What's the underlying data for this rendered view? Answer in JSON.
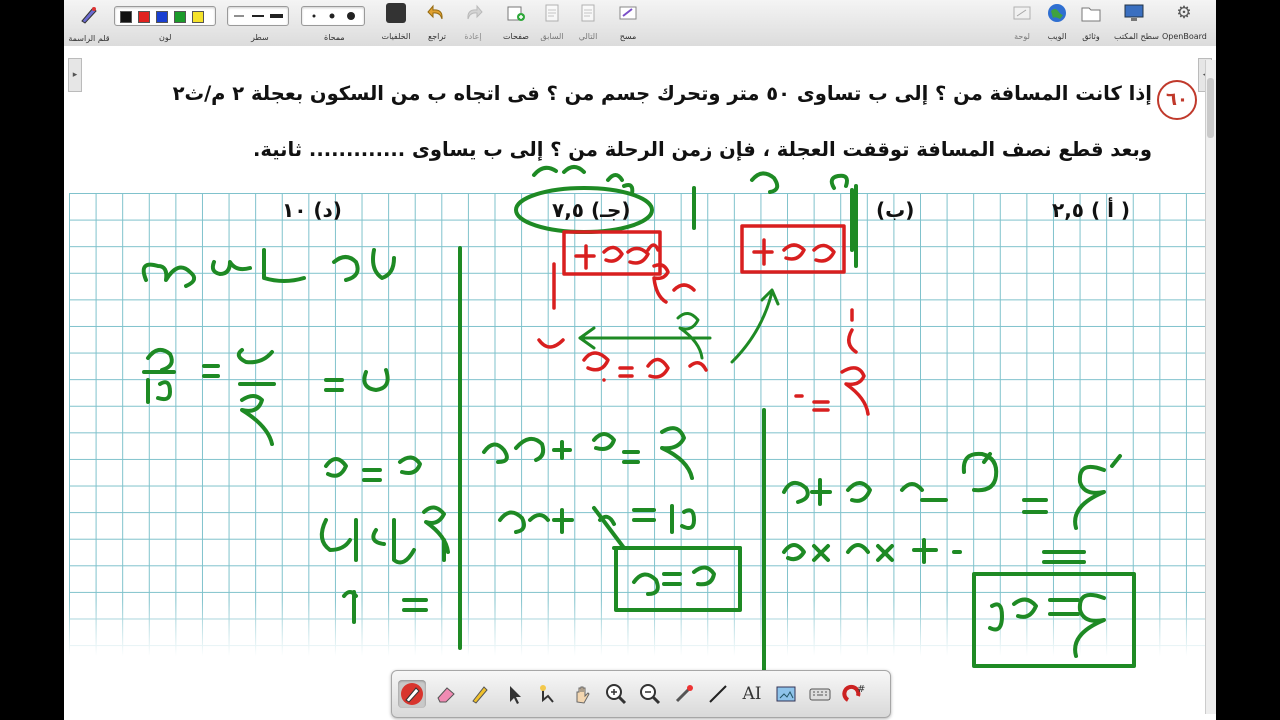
{
  "app": {
    "name": "OpenBoard"
  },
  "toolbar": {
    "left": [
      {
        "id": "pen-mode",
        "label": "قلم الراسمة",
        "icon": "pen-icon"
      },
      {
        "id": "color",
        "label": "لون",
        "icon": "color-palette"
      },
      {
        "id": "line",
        "label": "سطر",
        "icon": "line-width"
      },
      {
        "id": "eraser-size",
        "label": "ممحاة",
        "icon": "eraser-size"
      },
      {
        "id": "backgrounds",
        "label": "الخلفيات",
        "icon": "background-icon"
      },
      {
        "id": "undo",
        "label": "تراجع",
        "icon": "undo-icon"
      },
      {
        "id": "redo",
        "label": "إعادة",
        "icon": "redo-icon"
      },
      {
        "id": "pages",
        "label": "صفحات",
        "icon": "add-page-icon"
      },
      {
        "id": "previous",
        "label": "السابق",
        "icon": "previous-icon"
      },
      {
        "id": "next",
        "label": "التالي",
        "icon": "next-icon"
      },
      {
        "id": "clear",
        "label": "مسح",
        "icon": "erase-page-icon"
      }
    ],
    "right": [
      {
        "id": "board",
        "label": "لوحة",
        "icon": "board-icon"
      },
      {
        "id": "web",
        "label": "الويب",
        "icon": "web-icon"
      },
      {
        "id": "documents",
        "label": "وثائق",
        "icon": "documents-icon"
      },
      {
        "id": "desktop",
        "label": "سطح المكتب",
        "icon": "desktop-icon"
      },
      {
        "id": "openboard",
        "label": "OpenBoard",
        "icon": "gear-icon"
      }
    ],
    "colors": [
      "#111111",
      "#e0221f",
      "#1a3fd1",
      "#1b9b2a",
      "#f4e22a"
    ]
  },
  "question": {
    "number": "٦٠",
    "line1": "إذا كانت المسافة من ؟ إلى ب تساوى ٥٠ متر وتحرك جسم من ؟ فى اتجاه ب من السكون بعجلة ٢ م/ث٢",
    "line2": "وبعد قطع نصف المسافة توقفت العجلة ، فإن زمن الرحلة من ؟ إلى ب يساوى ............. ثانية.",
    "options": {
      "a": "( أ ) ٢,٥",
      "b": "(ب)",
      "c": "(جـ) ٧,٥",
      "d": "(د) ١٠"
    }
  },
  "palette": [
    "pen-tool-icon",
    "eraser-icon",
    "marker-icon",
    "selector-arrow-icon",
    "play-interact-icon",
    "hand-icon",
    "zoom-in-icon",
    "zoom-out-icon",
    "laser-pointer-icon",
    "line-tool-icon",
    "text-tool-icon",
    "capture-icon",
    "virtual-keyboard-icon",
    "magnifier-icon"
  ],
  "ink_colors": {
    "green": "#1e8a24",
    "red": "#d81f1f"
  }
}
